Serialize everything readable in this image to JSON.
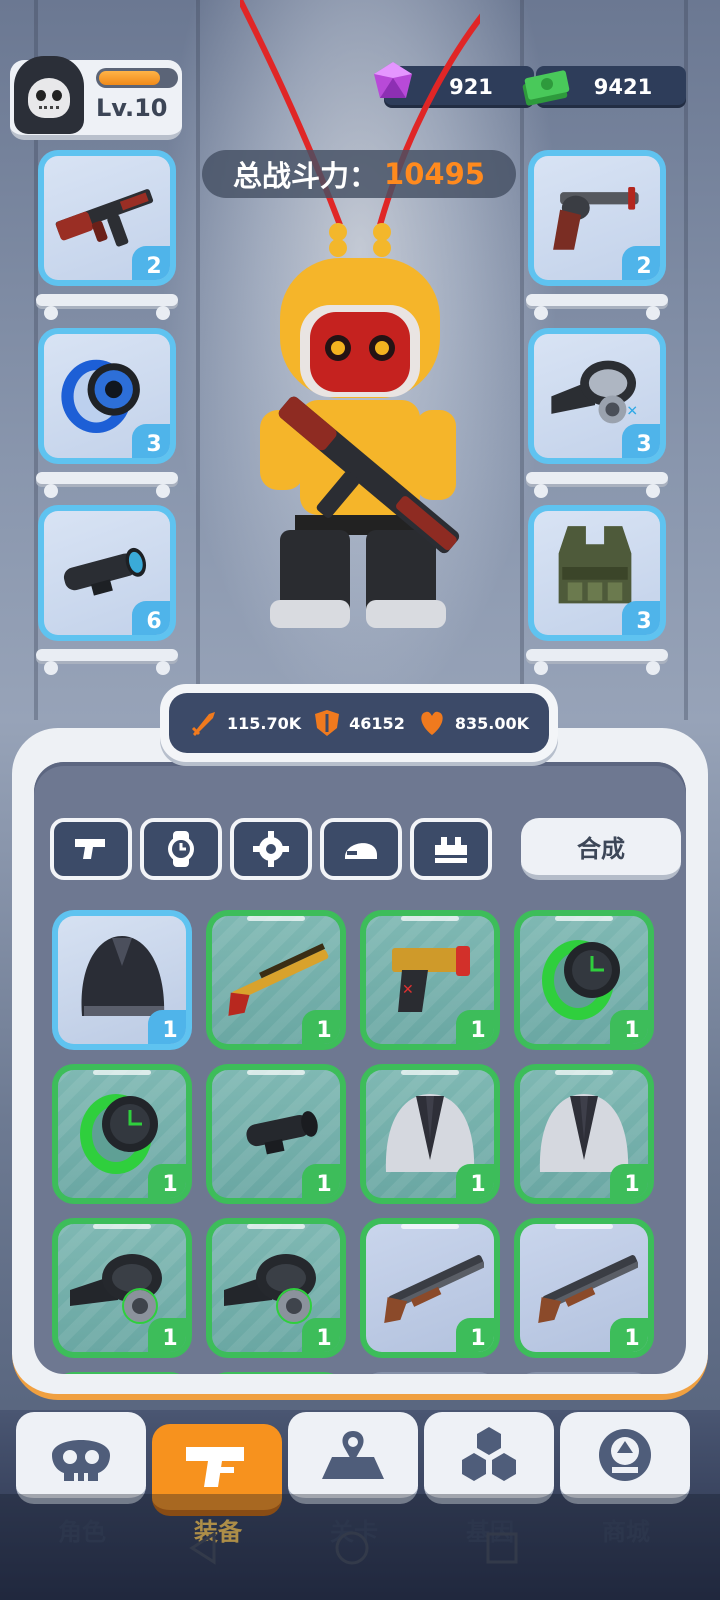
{
  "player": {
    "level": "Lv.10",
    "xp_fraction": 0.8
  },
  "currency": {
    "gems": "921",
    "cash": "9421"
  },
  "power": {
    "label": "总战斗力：",
    "value": "10495"
  },
  "equipped": {
    "left": [
      {
        "icon": "assault-rifle-icon",
        "count": "2"
      },
      {
        "icon": "blue-watch-icon",
        "count": "3"
      },
      {
        "icon": "scope-icon",
        "count": "6"
      }
    ],
    "right": [
      {
        "icon": "revolver-icon",
        "count": "2"
      },
      {
        "icon": "gas-mask-icon",
        "count": "3"
      },
      {
        "icon": "tactical-vest-icon",
        "count": "3"
      }
    ]
  },
  "stats": {
    "attack": "115.70K",
    "defense": "46152",
    "health": "835.00K"
  },
  "tabs": [
    "weapon-tab",
    "watch-tab",
    "gear-tab",
    "helmet-tab",
    "armor-tab"
  ],
  "merge_label": "合成",
  "inventory": [
    {
      "icon": "black-jacket-icon",
      "rarity": "blue",
      "count": "1"
    },
    {
      "icon": "shotgun-gold-icon",
      "rarity": "green",
      "count": "1"
    },
    {
      "icon": "pistol-gold-icon",
      "rarity": "green",
      "count": "1"
    },
    {
      "icon": "green-watch-icon",
      "rarity": "green",
      "count": "1"
    },
    {
      "icon": "green-watch-icon",
      "rarity": "green",
      "count": "1"
    },
    {
      "icon": "scope-icon",
      "rarity": "green",
      "count": "1"
    },
    {
      "icon": "suit-jacket-icon",
      "rarity": "green",
      "count": "1"
    },
    {
      "icon": "suit-jacket-icon",
      "rarity": "green",
      "count": "1"
    },
    {
      "icon": "gas-mask-icon",
      "rarity": "green",
      "count": "1"
    },
    {
      "icon": "gas-mask-icon",
      "rarity": "green",
      "count": "1"
    },
    {
      "icon": "shotgun-icon",
      "rarity": "green",
      "count": "1"
    },
    {
      "icon": "shotgun-icon",
      "rarity": "green",
      "count": "1"
    }
  ],
  "nav": [
    {
      "label": "角色",
      "icon": "skull-icon"
    },
    {
      "label": "装备",
      "icon": "gun-icon"
    },
    {
      "label": "关卡",
      "icon": "map-icon"
    },
    {
      "label": "基因",
      "icon": "hexagons-icon"
    },
    {
      "label": "商城",
      "icon": "shop-icon"
    }
  ]
}
